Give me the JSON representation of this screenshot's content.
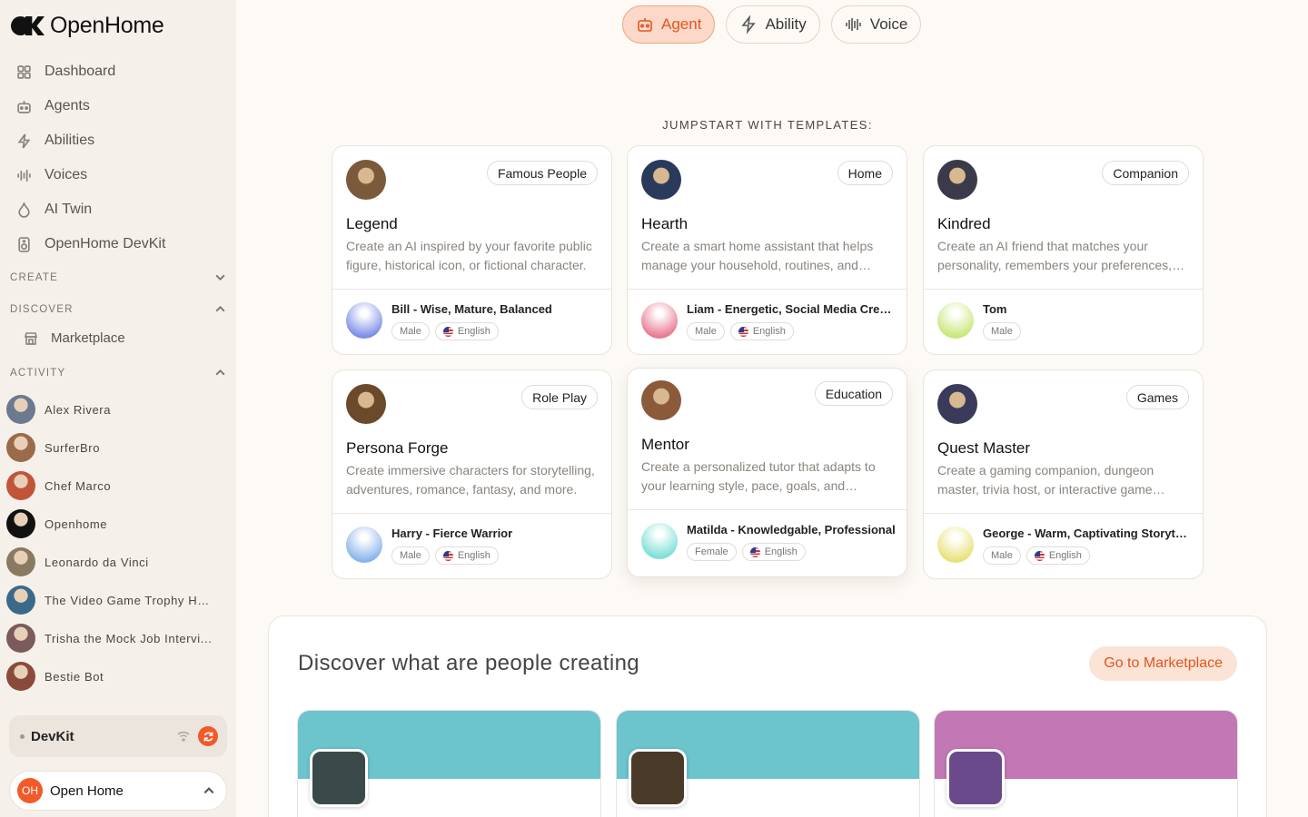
{
  "brand": {
    "name": "OpenHome"
  },
  "nav": [
    {
      "label": "Dashboard",
      "icon": "dashboard-icon"
    },
    {
      "label": "Agents",
      "icon": "robot-icon"
    },
    {
      "label": "Abilities",
      "icon": "lightning-icon"
    },
    {
      "label": "Voices",
      "icon": "waveform-icon"
    },
    {
      "label": "AI Twin",
      "icon": "flame-icon"
    },
    {
      "label": "OpenHome DevKit",
      "icon": "speaker-icon"
    }
  ],
  "sections": {
    "create": "CREATE",
    "discover": "DISCOVER",
    "activity": "ACTIVITY"
  },
  "marketplace_label": "Marketplace",
  "activity": [
    {
      "label": "Alex Rivera",
      "color": "#6b7a8f"
    },
    {
      "label": "SurferBro",
      "color": "#9a6b4a"
    },
    {
      "label": "Chef Marco",
      "color": "#c0553a"
    },
    {
      "label": "Openhome",
      "color": "#111111"
    },
    {
      "label": "Leonardo da Vinci",
      "color": "#8a7a62"
    },
    {
      "label": "The Video Game Trophy Hu...",
      "color": "#3a6a8a"
    },
    {
      "label": "Trisha the Mock Job Intervi...",
      "color": "#7a5a5a"
    },
    {
      "label": "Bestie Bot",
      "color": "#8a4a3a"
    }
  ],
  "devkit": {
    "label": "DevKit"
  },
  "account": {
    "initials": "OH",
    "name": "Open Home"
  },
  "toggle": {
    "agent": "Agent",
    "ability": "Ability",
    "voice": "Voice"
  },
  "jumpstart": "JUMPSTART WITH TEMPLATES:",
  "templates": [
    {
      "tag": "Famous People",
      "title": "Legend",
      "desc": "Create an AI inspired by your favorite public figure, historical icon, or fictional character.",
      "voice": "Bill - Wise, Mature, Balanced",
      "gender": "Male",
      "lang": "English",
      "avatar": "#7a5a3a",
      "voice_color": "#7d8ee8"
    },
    {
      "tag": "Home",
      "title": "Hearth",
      "desc": "Create a smart home assistant that helps manage your household, routines, and devices.",
      "voice": "Liam - Energetic, Social Media Creator",
      "gender": "Male",
      "lang": "English",
      "avatar": "#2a3a5a",
      "voice_color": "#ea7a92"
    },
    {
      "tag": "Companion",
      "title": "Kindred",
      "desc": "Create an AI friend that matches your personality, remembers your preferences, and more.",
      "voice": "Tom",
      "gender": "Male",
      "lang": "",
      "avatar": "#3a3a4a",
      "voice_color": "#c8e87a"
    },
    {
      "tag": "Role Play",
      "title": "Persona Forge",
      "desc": "Create immersive characters for storytelling, adventures, romance, fantasy, and more.",
      "voice": "Harry - Fierce Warrior",
      "gender": "Male",
      "lang": "English",
      "avatar": "#6a4a2a",
      "voice_color": "#8ab4ea"
    },
    {
      "tag": "Education",
      "title": "Mentor",
      "desc": "Create a personalized tutor that adapts to your learning style, pace, goals, and interests.",
      "voice": "Matilda - Knowledgable, Professional",
      "gender": "Female",
      "lang": "English",
      "avatar": "#8a5a3a",
      "voice_color": "#7ee0d6"
    },
    {
      "tag": "Games",
      "title": "Quest Master",
      "desc": "Create a gaming companion, dungeon master, trivia host, or interactive game guide.",
      "voice": "George - Warm, Captivating Storyteller",
      "gender": "Male",
      "lang": "English",
      "avatar": "#3a3a5a",
      "voice_color": "#e8e27a"
    }
  ],
  "discover": {
    "title": "Discover what are people creating",
    "button": "Go to Marketplace",
    "cards": [
      {
        "banner": "#6cc4cc",
        "pic": "#3a4a4a"
      },
      {
        "banner": "#6cc4cc",
        "pic": "#4a3a2a"
      },
      {
        "banner": "#c278b4",
        "pic": "#6a4a8a"
      }
    ]
  }
}
